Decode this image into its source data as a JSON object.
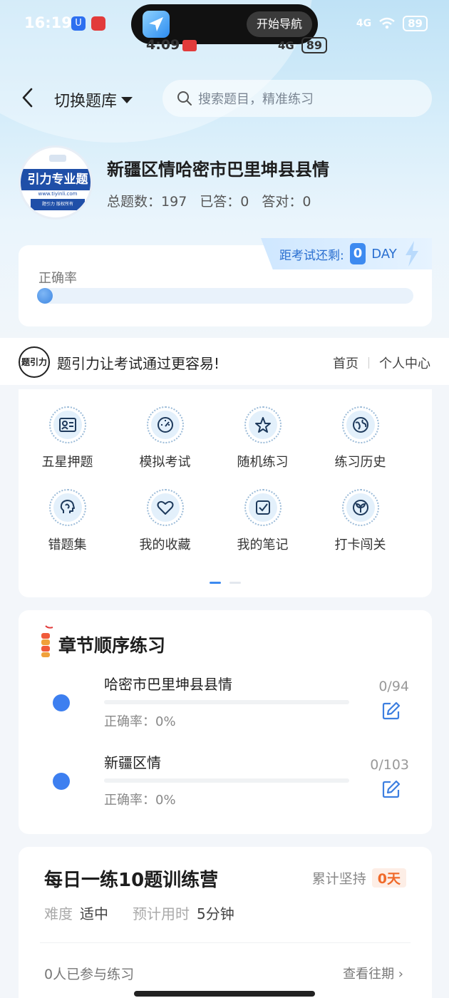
{
  "status_bar": {
    "time": "16:19",
    "app_badge": "U",
    "signal": "4G",
    "battery": "89",
    "island_button": "开始导航",
    "sub_time": "4:09",
    "sub_signal": "4G",
    "sub_battery": "89"
  },
  "header": {
    "switch_label": "切换题库",
    "search_placeholder": "搜索题目，精准练习"
  },
  "bank": {
    "logo_banner": "引力专业题",
    "logo_url": "www.tiyinli.com",
    "logo_band": "题引力 版权所有",
    "title": "新疆区情哈密市巴里坤县县情",
    "total_label": "总题数：",
    "total_value": "197",
    "answered_label": "已答：",
    "answered_value": "0",
    "correct_label": "答对：",
    "correct_value": "0"
  },
  "accuracy": {
    "label": "正确率",
    "progress": 0
  },
  "countdown": {
    "label": "距考试还剩:",
    "days": "0",
    "unit": "DAY"
  },
  "slogan": {
    "logo_text": "题引力",
    "text": "题引力让考试通过更容易!",
    "links": [
      "首页",
      "个人中心"
    ]
  },
  "grid": {
    "items": [
      {
        "label": "五星押题",
        "icon": "id-card-icon"
      },
      {
        "label": "模拟考试",
        "icon": "gauge-icon"
      },
      {
        "label": "随机练习",
        "icon": "star-network-icon"
      },
      {
        "label": "练习历史",
        "icon": "globe-history-icon"
      },
      {
        "label": "错题集",
        "icon": "brain-icon"
      },
      {
        "label": "我的收藏",
        "icon": "heart-icon"
      },
      {
        "label": "我的笔记",
        "icon": "checkbox-note-icon"
      },
      {
        "label": "打卡闯关",
        "icon": "sprout-icon"
      }
    ],
    "page": 1,
    "pages": 2
  },
  "chapters": {
    "title": "章节顺序练习",
    "items": [
      {
        "name": "哈密市巴里坤县县情",
        "rate": "正确率：0%",
        "count": "0/94"
      },
      {
        "name": "新疆区情",
        "rate": "正确率：0%",
        "count": "0/103"
      }
    ]
  },
  "daily": {
    "title": "每日一练10题训练营",
    "keep_label": "累计坚持",
    "keep_value": "0天",
    "difficulty_label": "难度",
    "difficulty_value": "适中",
    "time_label": "预计用时",
    "time_value": "5分钟",
    "joined": "0人已参与练习",
    "history_link": "查看往期 ›"
  }
}
